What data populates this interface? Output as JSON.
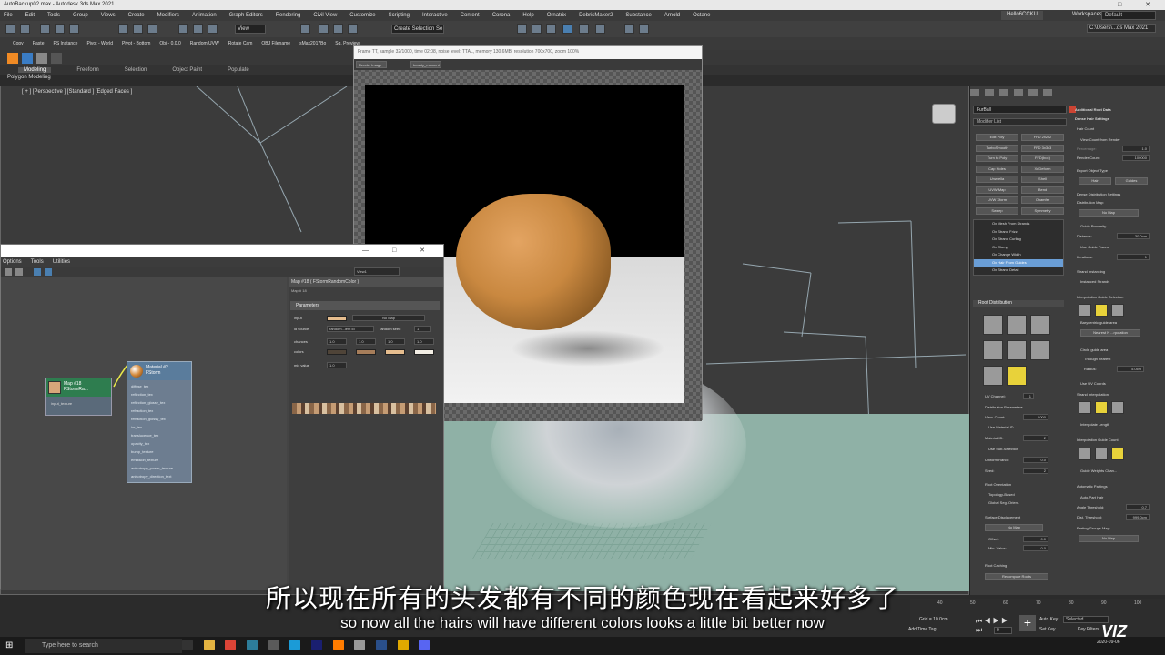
{
  "app": {
    "title": "AutoBackup02.max - Autodesk 3ds Max 2021",
    "window_controls": "— □ ✕"
  },
  "menu": [
    "File",
    "Edit",
    "Tools",
    "Group",
    "Views",
    "Create",
    "Modifiers",
    "Animation",
    "Graph Editors",
    "Rendering",
    "Civil View",
    "Customize",
    "Scripting",
    "Interactive",
    "Content",
    "Corona",
    "Help",
    "Ornatrix",
    "DebrisMaker2",
    "Substance",
    "Arnold",
    "Octane"
  ],
  "user": {
    "name": "Hello6CCKU",
    "workspaces_label": "Workspaces:",
    "workspace": "Default"
  },
  "toolbar": {
    "view_dropdown": "View",
    "selection_set": "Create Selection Se",
    "path": "C:\\Users\\...ds Max 2021"
  },
  "quickbar": [
    "Copy",
    "Paste",
    "PS Instance",
    "Pivot - World",
    "Pivot - Bottom",
    "Obj - 0,0,0",
    "Random UVW",
    "Rotate Cam",
    "OBJ Filename",
    "sMax2017Bo",
    "Sq. Preview"
  ],
  "ribbon": {
    "tabs": [
      "Modeling",
      "Freeform",
      "Selection",
      "Object Paint",
      "Populate"
    ],
    "active": "Modeling",
    "sub": "Polygon Modeling"
  },
  "viewport": {
    "label": "[ + ] [Perspective ] [Standard ] [Edged Faces ]"
  },
  "frame_buffer": {
    "title": "Frame TT, sample 32/1000, time 02:08, noise level: TTAL, memory 130.6MB, resolution 700x700, zoom 100%",
    "render_dropdown": "Render Image",
    "channel_dropdown": "beauty_moment"
  },
  "material_editor": {
    "menu": [
      "Options",
      "Tools",
      "Utilities"
    ],
    "view_dropdown": "View1",
    "node_map": {
      "title_line1": "Map #18",
      "title_line2": "FStormRa...",
      "slot": "input_texture"
    },
    "node_mat": {
      "title_line1": "Material #2",
      "title_line2": "FStorm",
      "slots": [
        "diffuse_tex",
        "reflection_tex",
        "reflection_glossy_tex",
        "refraction_tex",
        "refraction_glossy_tex",
        "ior_tex",
        "translucence_tex",
        "opacity_tex",
        "bump_texture",
        "emission_texture",
        "anisotropy_power_texture",
        "anisotropy_direction_text"
      ]
    },
    "params": {
      "header": "Map #18 ( FStormRandomColor )",
      "subheader": "Map # 18",
      "rollout": "Parameters",
      "input_label": "input",
      "input_value": "No Map",
      "id_source_label": "id source",
      "id_source_value": "random...lent id",
      "random_seed_label": "random seed",
      "random_seed_value": "1",
      "chances_label": "chances",
      "chances": [
        "1.0",
        "1.0",
        "1.0",
        "1.0"
      ],
      "colors_label": "colors",
      "colors": [
        "#4f4438",
        "#a67d5a",
        "#e6bd8e",
        "#f2ede4"
      ],
      "mix_label": "mix value",
      "mix_value": "1.0"
    }
  },
  "command_panel": {
    "object_name": "FurBall",
    "modifier_list": "Modifier List",
    "buttons": [
      [
        "Edit Poly",
        "FFD 2x2x2"
      ],
      [
        "TurboSmooth",
        "FFD 3x3x3"
      ],
      [
        "Turn to Poly",
        "FFD(box)"
      ],
      [
        "Cap Holes",
        "XeDeform"
      ],
      [
        "Unwrella",
        "Shell"
      ],
      [
        "UVW Map",
        "Bend"
      ],
      [
        "UVW Xform",
        "Chamfer"
      ],
      [
        "Sweep",
        "Symmetry"
      ]
    ],
    "stack": [
      "Ox Mesh From Strands",
      "Ox Strand Frizz",
      "Ox Strand Curling",
      "Ox Clump",
      "Ox Change Width",
      "Ox Hair From Guides",
      "Ox Strand Detail"
    ],
    "stack_selected": 5,
    "root_distribution": {
      "title": "Root Distribution",
      "uv_channel_label": "UV Channel:",
      "uv_channel": "1",
      "params_label": "Distribution Parameters",
      "view_count_label": "View. Count:",
      "view_count": "1000",
      "use_material_id": "Use Material ID",
      "material_id_label": "Material ID:",
      "material_id": "2",
      "use_subselection": "Use Sub-Selection",
      "uniform_rand_label": "Uniform Rand.:",
      "uniform_rand": "0.0",
      "seed_label": "Seed:",
      "seed": "2",
      "root_orientation": "Root Orientation",
      "topology_based": "Topology-Based",
      "global_seg_orient": "Global Seg. Orient.",
      "surface_displacement": "Surface Displacement",
      "no_map": "No Map",
      "offset_label": "Offset:",
      "offset": "0.0",
      "min_value_label": "Min. Value:",
      "min_value": "0.0",
      "root_caching": "Root Caching",
      "recompute_roots": "Recompute Roots"
    },
    "right": {
      "additional_root_data": "Additional Root Data",
      "dense_hair_settings": "Dense Hair Settings",
      "hair_count": "Hair Count",
      "view_count_from_render": "View Count from Render",
      "percentage_label": "Percentage:",
      "percentage": "1.0",
      "render_count_label": "Render Count:",
      "render_count": "100000",
      "export_object_type": "Export Object Type",
      "hair_btn": "Hair",
      "guides_btn": "Guides",
      "dense_distribution": "Dense Distribution Settings",
      "distribution_map": "Distribution Map:",
      "dist_no_map": "No Map",
      "guide_proximity": "Guide Proximity",
      "distance_label": "Distance:",
      "distance": "30.0cm",
      "use_guide_faces": "Use Guide Faces",
      "iterations_label": "Iterations:",
      "iterations": "1",
      "strand_instancing": "Strand Instancing",
      "instanced_strands": "Instanced Strands",
      "interp_guide_selection": "Interpolation Guide Selection",
      "barycentric": "Barycentric guide area",
      "nearest_n": "Nearest N ...rpolation",
      "circle_guide": "Circle guide area",
      "through_nearest": "Through nearest",
      "radius_label": "Radius:",
      "radius": "5.0cm",
      "use_uv_coords": "Use UV Coords",
      "strand_interp": "Strand Interpolation",
      "interp_length": "Interpolate Length",
      "interp_guide_count": "Interpolation Guide Count",
      "guide_weights": "Guide Weights Chan...",
      "auto_partings": "Automatic Partings",
      "auto_part_hair": "Auto-Part Hair",
      "angle_threshold_label": "Angle Threshold:",
      "angle_threshold": "0.7",
      "dist_threshold_label": "Dist. Threshold:",
      "dist_threshold": "999.0cm",
      "parting_groups_map": "Parting Groups Map:",
      "parting_no_map": "No Map"
    }
  },
  "timeline": {
    "ticks": [
      "40",
      "50",
      "60",
      "70",
      "80",
      "90",
      "100"
    ],
    "grid": "Grid = 10.0cm",
    "add_time_tag": "Add Time Tag",
    "frame": "0",
    "frames": "100",
    "auto_key": "Auto Key",
    "set_key": "Set Key",
    "selected": "Selected",
    "key_filters": "Key Filters..."
  },
  "taskbar": {
    "search_placeholder": "Type here to search",
    "time": "2020-09-06"
  },
  "subtitle": {
    "chinese": "所以现在所有的头发都有不同的颜色现在看起来好多了",
    "english": "so now all the hairs will have different colors looks a little bit better now"
  },
  "watermark": "VIZ"
}
